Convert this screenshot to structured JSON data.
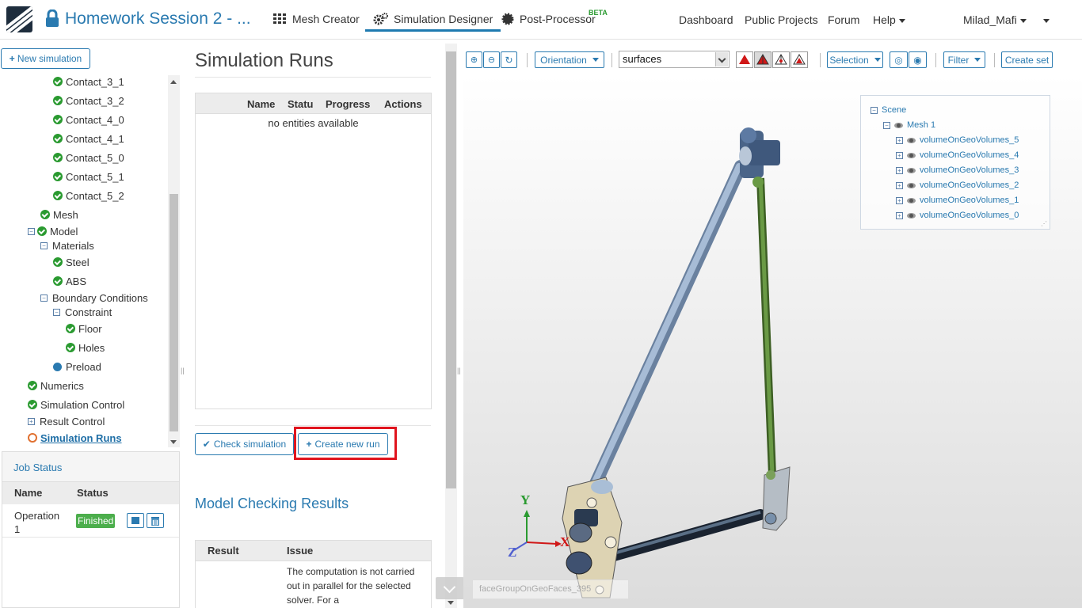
{
  "header": {
    "project_title": "Homework Session 2 - ...",
    "tabs": [
      {
        "label": "Mesh Creator",
        "icon": "grid-icon"
      },
      {
        "label": "Simulation Designer",
        "icon": "gears-icon"
      },
      {
        "label": "Post-Processor",
        "icon": "cog-icon",
        "badge": "BETA"
      }
    ],
    "links": [
      "Dashboard",
      "Public Projects",
      "Forum",
      "Help"
    ],
    "user": "Milad_Mafi"
  },
  "sidebar": {
    "new_simulation_label": "New simulation",
    "tree": [
      {
        "label": "Contact_3_1",
        "status": "done"
      },
      {
        "label": "Contact_3_2",
        "status": "done"
      },
      {
        "label": "Contact_4_0",
        "status": "done"
      },
      {
        "label": "Contact_4_1",
        "status": "done"
      },
      {
        "label": "Contact_5_0",
        "status": "done"
      },
      {
        "label": "Contact_5_1",
        "status": "done"
      },
      {
        "label": "Contact_5_2",
        "status": "done"
      },
      {
        "label": "Mesh",
        "status": "done"
      },
      {
        "label": "Model",
        "status": "done"
      },
      {
        "label": "Materials",
        "status": "folder"
      },
      {
        "label": "Steel",
        "status": "done"
      },
      {
        "label": "ABS",
        "status": "done"
      },
      {
        "label": "Boundary Conditions",
        "status": "folder"
      },
      {
        "label": "Constraint",
        "status": "folder"
      },
      {
        "label": "Floor",
        "status": "done"
      },
      {
        "label": "Holes",
        "status": "done"
      },
      {
        "label": "Preload",
        "status": "pending"
      },
      {
        "label": "Numerics",
        "status": "done"
      },
      {
        "label": "Simulation Control",
        "status": "done"
      },
      {
        "label": "Result Control",
        "status": "folder-collapsed"
      },
      {
        "label": "Simulation Runs",
        "status": "active"
      }
    ]
  },
  "job_status": {
    "title": "Job Status",
    "columns": [
      "Name",
      "Status"
    ],
    "rows": [
      {
        "name_line1": "Operation",
        "name_line2": "1",
        "status": "Finished"
      }
    ]
  },
  "runs": {
    "title": "Simulation Runs",
    "columns": [
      "Name",
      "Status",
      "Progress",
      "Actions"
    ],
    "empty_text": "no entities available",
    "check_button": "Check simulation",
    "create_button": "Create new run"
  },
  "model_checking": {
    "title": "Model Checking Results",
    "columns": [
      "Result",
      "Issue"
    ],
    "issue_text": "The computation is not carried out in parallel for the selected solver. For a"
  },
  "viewer": {
    "orientation_label": "Orientation",
    "render_mode": "surfaces",
    "selection_label": "Selection",
    "filter_label": "Filter",
    "create_set_label": "Create set",
    "scene": {
      "root": "Scene",
      "mesh": "Mesh 1",
      "volumes": [
        "volumeOnGeoVolumes_5",
        "volumeOnGeoVolumes_4",
        "volumeOnGeoVolumes_3",
        "volumeOnGeoVolumes_2",
        "volumeOnGeoVolumes_1",
        "volumeOnGeoVolumes_0"
      ]
    },
    "hover_label": "faceGroupOnGeoFaces_395",
    "axes": {
      "x": "X",
      "y": "Y",
      "z": "Z"
    }
  },
  "colors": {
    "accent": "#2a7ab0",
    "success": "#2a9a30",
    "highlight": "#e0141e",
    "rod_blue": "#8ea8c8",
    "rod_green": "#5c8a3a"
  }
}
